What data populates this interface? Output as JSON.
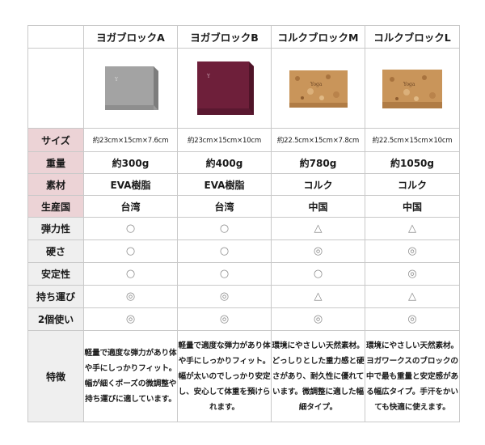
{
  "header": {
    "corner": "",
    "products": [
      "ヨガブロックA",
      "ヨガブロックB",
      "コルクブロックM",
      "コルクブロックL"
    ]
  },
  "images": [
    {
      "icon": "gray-yoga-block-image",
      "color": "#8c8c8c"
    },
    {
      "icon": "burgundy-yoga-block-image",
      "color": "#6e1f3a"
    },
    {
      "icon": "cork-block-m-image",
      "color": "#c9955a"
    },
    {
      "icon": "cork-block-l-image",
      "color": "#c9955a"
    }
  ],
  "rows": {
    "size": {
      "label": "サイズ",
      "values": [
        "約23cm×15cm×7.6cm",
        "約23cm×15cm×10cm",
        "約22.5cm×15cm×7.8cm",
        "約22.5cm×15cm×10cm"
      ]
    },
    "weight": {
      "label": "重量",
      "values": [
        "約300g",
        "約400g",
        "約780g",
        "約1050g"
      ]
    },
    "material": {
      "label": "素材",
      "values": [
        "EVA樹脂",
        "EVA樹脂",
        "コルク",
        "コルク"
      ]
    },
    "origin": {
      "label": "生産国",
      "values": [
        "台湾",
        "台湾",
        "中国",
        "中国"
      ]
    },
    "elasticity": {
      "label": "弾力性",
      "values": [
        "○",
        "○",
        "△",
        "△"
      ]
    },
    "hardness": {
      "label": "硬さ",
      "values": [
        "○",
        "○",
        "◎",
        "◎"
      ]
    },
    "stability": {
      "label": "安定性",
      "values": [
        "○",
        "○",
        "○",
        "◎"
      ]
    },
    "portability": {
      "label": "持ち運び",
      "values": [
        "◎",
        "◎",
        "△",
        "△"
      ]
    },
    "pair_use": {
      "label": "2個使い",
      "values": [
        "◎",
        "◎",
        "◎",
        "◎"
      ]
    },
    "features": {
      "label": "特徴",
      "values": [
        "軽量で適度な弾力があり体や手にしっかりフィット。幅が細くポーズの微調整や持ち運びに適しています。",
        "軽量で適度な弾力があり体や手にしっかりフィット。幅が太いのでしっかり安定し、安心して体重を預けられます。",
        "環境にやさしい天然素材。どっしりとした重力感と硬さがあり、耐久性に優れています。微調整に適した幅細タイプ。",
        "環境にやさしい天然素材。ヨガワークスのブロックの中で最も重量と安定感がある幅広タイプ。手汗をかいても快適に使えます。"
      ]
    }
  },
  "colors": {
    "label_pink": "#ecd3d6",
    "label_gray": "#efefef",
    "symbol": "#8a8a8a",
    "border": "#c9c9c9"
  }
}
